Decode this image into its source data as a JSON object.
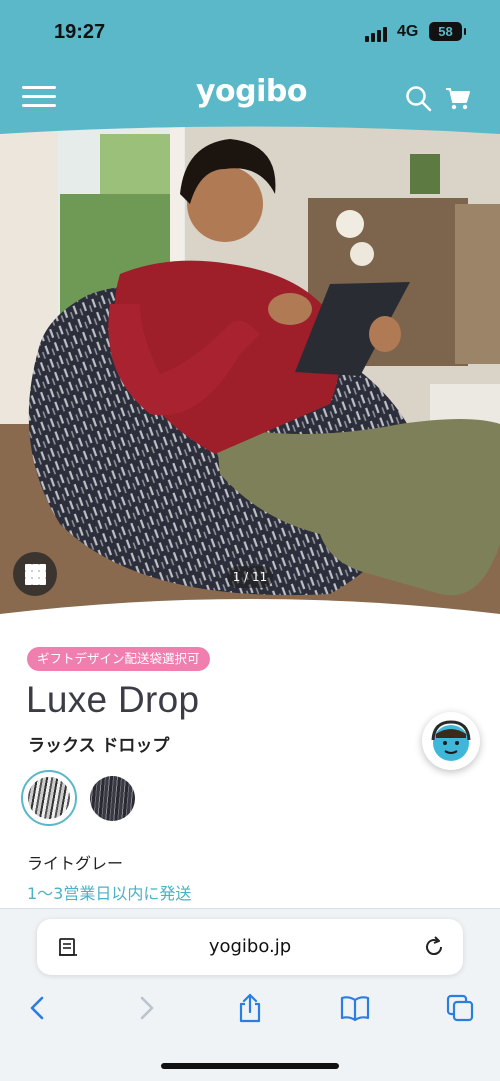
{
  "status_bar": {
    "time": "19:27",
    "network": "4G",
    "battery": "58"
  },
  "header": {
    "logo": "yogibo",
    "menu_icon": "hamburger-menu-icon",
    "search_icon": "search-icon",
    "cart_icon": "cart-icon"
  },
  "gallery": {
    "counter": "1 / 11",
    "grid_icon": "grid-view-icon"
  },
  "product": {
    "badge": "ギフトデザイン配送袋選択可",
    "name": "Luxe Drop",
    "name_kana": "ラックス ドロップ",
    "selected_color": "ライトグレー",
    "shipping": "1〜3営業日以内に発送"
  },
  "browser": {
    "url": "yogibo.jp"
  },
  "colors": {
    "brand": "#5ab8c8",
    "badge": "#f07fb0",
    "link": "#4ab2c4"
  }
}
